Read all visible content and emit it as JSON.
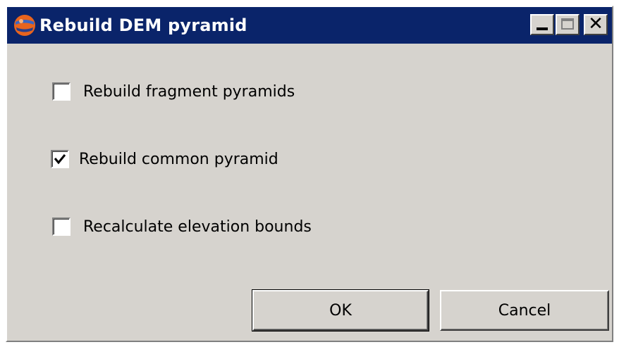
{
  "window": {
    "title": "Rebuild DEM pyramid"
  },
  "titlebar_buttons": {
    "close_symbol": "✕"
  },
  "options": [
    {
      "label": "Rebuild fragment pyramids",
      "checked": false
    },
    {
      "label": "Rebuild common pyramid",
      "checked": true
    },
    {
      "label": "Recalculate elevation bounds",
      "checked": false
    }
  ],
  "buttons": {
    "ok_label": "OK",
    "cancel_label": "Cancel"
  },
  "colors": {
    "titlebar": "#0a246a",
    "dialog_background": "#d6d3ce"
  },
  "icons": {
    "app": "app-globe-icon",
    "check": "checkmark-icon"
  }
}
